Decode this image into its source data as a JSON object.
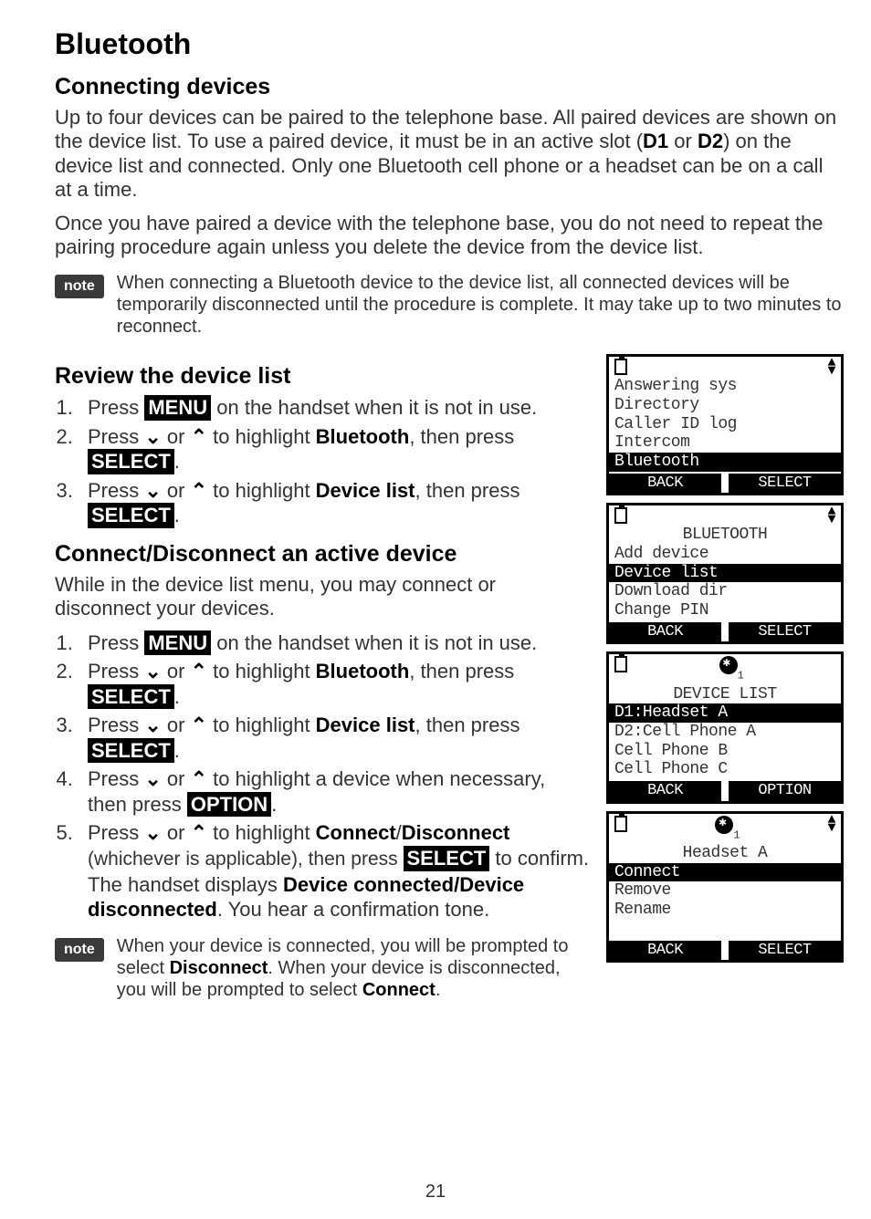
{
  "title": "Bluetooth",
  "section1": {
    "heading": "Connecting devices",
    "para1": "Up to four devices can be paired to the telephone base. All paired devices are shown on the device list. To use a paired device, it must be in an active slot (",
    "d1": "D1",
    "para1b": " or ",
    "d2": "D2",
    "para1c": ") on the device list and connected. Only one Bluetooth cell phone or a headset can be on a call at a time.",
    "para2": "Once you have paired a device with the telephone base, you do not need to repeat the pairing procedure again unless you delete the device from the device list."
  },
  "note1": {
    "badge": "note",
    "text": "When connecting a Bluetooth device to the device list, all connected devices will be temporarily disconnected until the procedure is complete. It may take up to two minutes to reconnect."
  },
  "section2": {
    "heading": "Review the device list",
    "s1a": "Press ",
    "s1_btn": "MENU",
    "s1b": " on the handset when it is not in use.",
    "s2a": "Press ",
    "s2b": " or ",
    "s2c": " to highlight ",
    "s2_bold": "Bluetooth",
    "s2d": ", then press ",
    "s2_btn": "SELECT",
    "s2e": ".",
    "s3a": "Press ",
    "s3b": " or ",
    "s3c": " to highlight ",
    "s3_bold": "Device list",
    "s3d": ", then press ",
    "s3_btn": "SELECT",
    "s3e": "."
  },
  "section3": {
    "heading": "Connect/Disconnect an active device",
    "intro": "While in the device list menu, you may connect or disconnect your devices.",
    "s1a": "Press ",
    "s1_btn": "MENU",
    "s1b": " on the handset when it is not in use.",
    "s2a": "Press ",
    "s2b": " or ",
    "s2c": " to highlight ",
    "s2_bold": "Bluetooth",
    "s2d": ", then press ",
    "s2_btn": "SELECT",
    "s2e": ".",
    "s3a": "Press ",
    "s3b": " or ",
    "s3c": " to highlight ",
    "s3_bold": "Device list",
    "s3d": ", then press ",
    "s3_btn": "SELECT",
    "s3e": ".",
    "s4a": "Press ",
    "s4b": " or ",
    "s4c": " to highlight a device when necessary, then press ",
    "s4_btn": "OPTION",
    "s4d": ".",
    "s5a": "Press ",
    "s5b": " or ",
    "s5c": " to highlight ",
    "s5_bold1": "Connect",
    "s5_slash": "/",
    "s5_bold2": "Disconnect",
    "s5_paren": " (whichever is applicable), then press ",
    "s5_btn": "SELECT",
    "s5d": " to confirm. The handset displays ",
    "s5_bold3": "Device connected/Device disconnected",
    "s5e": ". You hear a confirmation tone."
  },
  "note2": {
    "badge": "note",
    "t1": "When your device is connected, you will be prompted to select ",
    "b1": "Disconnect",
    "t2": ". When your device is disconnected, you will be prompted to select ",
    "b2": "Connect",
    "t3": "."
  },
  "lcd1": {
    "r1": "Answering sys",
    "r2": "Directory",
    "r3": "Caller ID log",
    "r4": "Intercom",
    "r5": "Bluetooth",
    "back": "BACK",
    "select": "SELECT"
  },
  "lcd2": {
    "title": "BLUETOOTH",
    "r1": "Add device",
    "r2": "Device list",
    "r3": "Download dir",
    "r4": "Change PIN",
    "back": "BACK",
    "select": "SELECT"
  },
  "lcd3": {
    "title": "DEVICE LIST",
    "r1": "D1:Headset A",
    "r2": "D2:Cell Phone A",
    "r3": "Cell Phone B",
    "r4": "Cell Phone C",
    "back": "BACK",
    "option": "OPTION"
  },
  "lcd4": {
    "title": "Headset A",
    "r1": "Connect",
    "r2": "Remove",
    "r3": "Rename",
    "back": "BACK",
    "select": "SELECT"
  },
  "page": "21"
}
